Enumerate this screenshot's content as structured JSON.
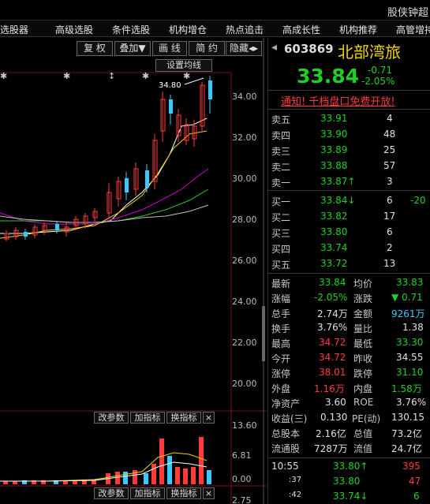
{
  "topbar": {
    "right_title": "股侠钟超"
  },
  "nav": {
    "items": [
      "选股器",
      "高级选股",
      "条件选股",
      "机构增仓",
      "热点追击",
      "高成长性",
      "机构推荐",
      "高管增持"
    ]
  },
  "toolbar": {
    "buttons": [
      "复 权",
      "叠加▼",
      "画 线",
      "简 约",
      "隐藏◂▸"
    ]
  },
  "chart": {
    "settings_label": "设置均线",
    "high_marker": "34.80",
    "price_ticks": [
      "34.00",
      "32.00",
      "30.00",
      "28.00",
      "26.00",
      "24.00",
      "22.00",
      "20.00"
    ],
    "vol_ticks": [
      "13.60",
      "6.81",
      "0.00"
    ],
    "bottom_tick": "2.75",
    "mid_buttons": [
      "改参数",
      "加指标",
      "换指标",
      "×"
    ],
    "bot_buttons": [
      "改参数",
      "加指标",
      "换指标",
      "×"
    ]
  },
  "quote": {
    "code": "603869",
    "name": "北部湾旅",
    "price": "33.84",
    "change": "-0.71",
    "change_pct": "-2.05%",
    "notice": "通知! 千档盘口免费开放!"
  },
  "asks": [
    {
      "label": "卖五",
      "price": "33.91",
      "vol": "4",
      "extra": ""
    },
    {
      "label": "卖四",
      "price": "33.90",
      "vol": "48",
      "extra": ""
    },
    {
      "label": "卖三",
      "price": "33.89",
      "vol": "25",
      "extra": ""
    },
    {
      "label": "卖二",
      "price": "33.88",
      "vol": "57",
      "extra": ""
    },
    {
      "label": "卖一",
      "price": "33.87↑",
      "vol": "3",
      "extra": ""
    }
  ],
  "bids": [
    {
      "label": "买一",
      "price": "33.84↓",
      "vol": "6",
      "extra": "-20"
    },
    {
      "label": "买二",
      "price": "33.82",
      "vol": "17",
      "extra": ""
    },
    {
      "label": "买三",
      "price": "33.80",
      "vol": "6",
      "extra": ""
    },
    {
      "label": "买四",
      "price": "33.74",
      "vol": "2",
      "extra": ""
    },
    {
      "label": "买五",
      "price": "33.72",
      "vol": "13",
      "extra": ""
    }
  ],
  "stats": [
    {
      "l1": "最新",
      "v1": "33.84",
      "l2": "均价",
      "v2": "33.83"
    },
    {
      "l1": "涨幅",
      "v1": "-2.05%",
      "l2": "涨跌",
      "v2": "▼ 0.71"
    },
    {
      "l1": "总手",
      "v1": "2.74万",
      "l2": "金额",
      "v2": "9261万"
    },
    {
      "l1": "换手",
      "v1": "3.76%",
      "l2": "量比",
      "v2": "1.38"
    },
    {
      "l1": "最高",
      "v1": "34.72",
      "l2": "最低",
      "v2": "33.30"
    },
    {
      "l1": "今开",
      "v1": "34.72",
      "l2": "昨收",
      "v2": "34.55"
    },
    {
      "l1": "涨停",
      "v1": "38.01",
      "l2": "跌停",
      "v2": "31.10"
    },
    {
      "l1": "外盘",
      "v1": "1.16万",
      "l2": "内盘",
      "v2": "1.58万"
    },
    {
      "l1": "净资产",
      "v1": "3.60",
      "l2": "ROE",
      "v2": "3.76%"
    },
    {
      "l1": "收益(三)",
      "v1": "0.130",
      "l2": "PE(动)",
      "v2": "130.15"
    },
    {
      "l1": "总股本",
      "v1": "2.16亿",
      "l2": "总值",
      "v2": "73.2亿"
    },
    {
      "l1": "流通股",
      "v1": "7287万",
      "l2": "流值",
      "v2": "24.7亿"
    }
  ],
  "ticks": [
    {
      "time": "10:55",
      "price": "33.80↑",
      "vol": "395"
    },
    {
      "time": ":37",
      "price": "33.80",
      "vol": "47"
    },
    {
      "time": ":42",
      "price": "33.74↓",
      "vol": "6"
    }
  ],
  "colors": {
    "up": "#ff3b3b",
    "down": "#20d020",
    "ma_white": "#ffffff",
    "ma_yellow": "#f2d300",
    "ma_magenta": "#d000d0",
    "ma_green": "#30c030"
  }
}
